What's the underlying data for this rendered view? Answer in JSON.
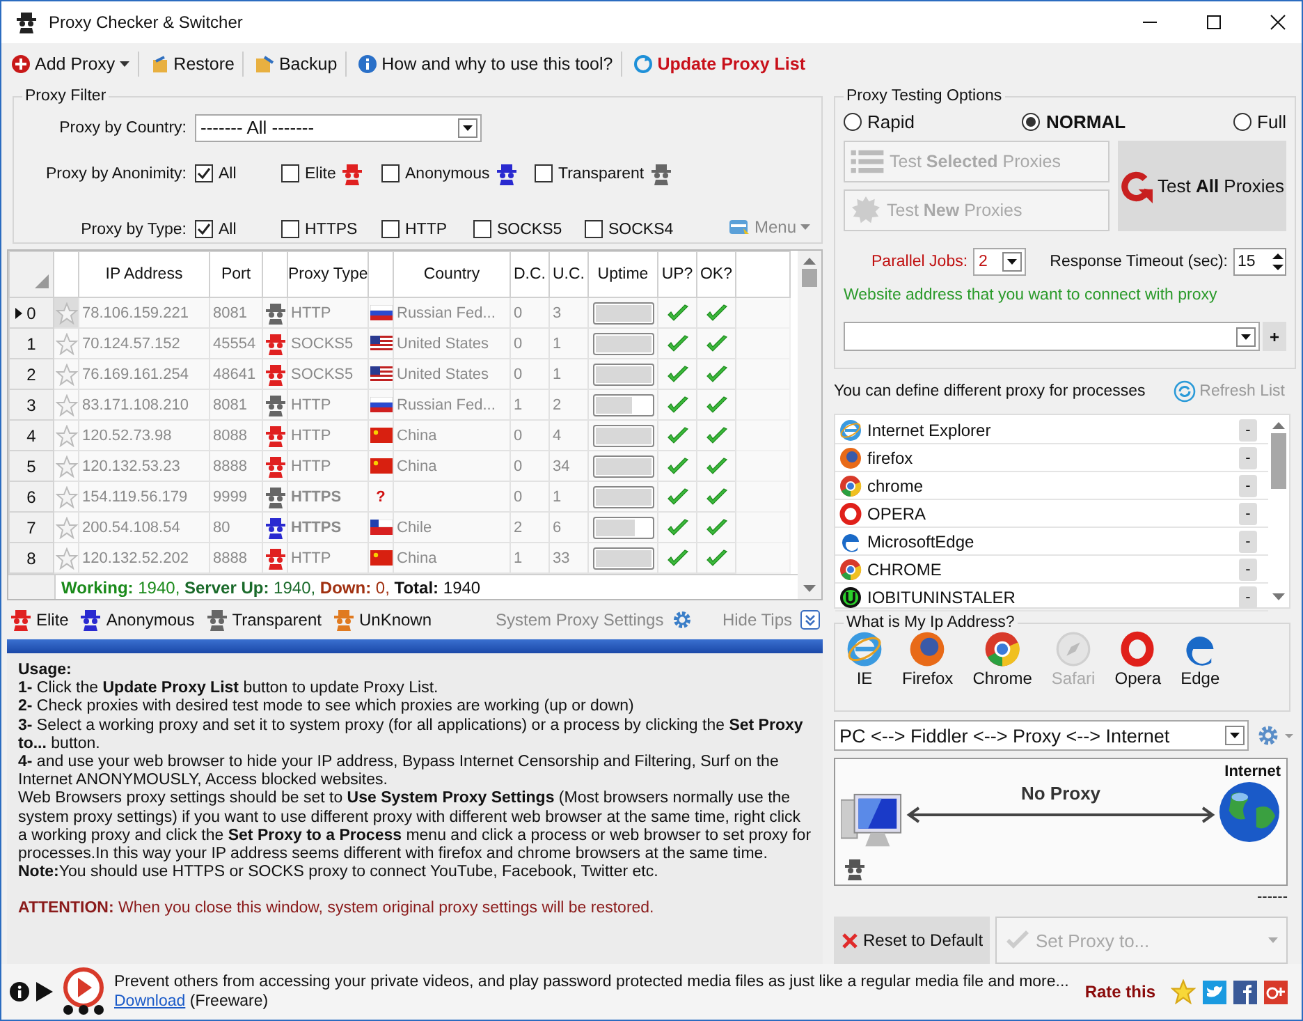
{
  "window": {
    "title": "Proxy Checker & Switcher"
  },
  "toolbar": [
    {
      "label": "Add Proxy",
      "kind": "dropdown"
    },
    {
      "label": "Restore",
      "kind": "button"
    },
    {
      "label": "Backup",
      "kind": "button"
    },
    {
      "label": "How and why to use this tool?",
      "kind": "button"
    },
    {
      "label": "Update Proxy List",
      "kind": "highlight"
    }
  ],
  "filter": {
    "title": "Proxy Filter",
    "country_label": "Proxy by Country:",
    "country_value": "------- All -------",
    "anonymity": {
      "label": "Proxy by Anonimity:",
      "options": [
        {
          "label": "All",
          "checked": true
        },
        {
          "label": "Elite",
          "checked": false,
          "kind": "elite"
        },
        {
          "label": "Anonymous",
          "checked": false,
          "kind": "anonymous"
        },
        {
          "label": "Transparent",
          "checked": false,
          "kind": "transparent"
        }
      ]
    },
    "type": {
      "label": "Proxy by Type:",
      "options": [
        {
          "label": "All",
          "checked": true
        },
        {
          "label": "HTTPS",
          "checked": false
        },
        {
          "label": "HTTP",
          "checked": false
        },
        {
          "label": "SOCKS5",
          "checked": false
        },
        {
          "label": "SOCKS4",
          "checked": false
        }
      ]
    },
    "menu_label": "Menu"
  },
  "table": {
    "columns": [
      "IP Address",
      "Port",
      "Proxy Type",
      "Country",
      "D.C.",
      "U.C.",
      "Uptime",
      "UP?",
      "OK?"
    ],
    "rows": [
      {
        "index": "0",
        "selected": true,
        "ip": "78.106.159.221",
        "port": "8081",
        "kind": "transparent",
        "type": "HTTP",
        "secure": false,
        "flag": {
          "kind": "ru"
        },
        "country": "Russian Fed...",
        "dc": "0",
        "uc": "3",
        "level": 1,
        "up": true,
        "ok": true
      },
      {
        "index": "1",
        "selected": false,
        "ip": "70.124.57.152",
        "port": "45554",
        "kind": "elite",
        "type": "SOCKS5",
        "secure": false,
        "flag": {
          "kind": "us"
        },
        "country": "United States",
        "dc": "0",
        "uc": "1",
        "level": 1,
        "up": true,
        "ok": true
      },
      {
        "index": "2",
        "selected": false,
        "ip": "76.169.161.254",
        "port": "48641",
        "kind": "elite",
        "type": "SOCKS5",
        "secure": false,
        "flag": {
          "kind": "us"
        },
        "country": "United States",
        "dc": "0",
        "uc": "1",
        "level": 1,
        "up": true,
        "ok": true
      },
      {
        "index": "3",
        "selected": false,
        "ip": "83.171.108.210",
        "port": "8081",
        "kind": "transparent",
        "type": "HTTP",
        "secure": false,
        "flag": {
          "kind": "ru"
        },
        "country": "Russian Fed...",
        "dc": "1",
        "uc": "2",
        "level": 0.65,
        "up": true,
        "ok": true
      },
      {
        "index": "4",
        "selected": false,
        "ip": "120.52.73.98",
        "port": "8088",
        "kind": "elite",
        "type": "HTTP",
        "secure": false,
        "flag": {
          "kind": "cn"
        },
        "country": "China",
        "dc": "0",
        "uc": "4",
        "level": 1,
        "up": true,
        "ok": true
      },
      {
        "index": "5",
        "selected": false,
        "ip": "120.132.53.23",
        "port": "8888",
        "kind": "elite",
        "type": "HTTP",
        "secure": false,
        "flag": {
          "kind": "cn"
        },
        "country": "China",
        "dc": "0",
        "uc": "34",
        "level": 1,
        "up": true,
        "ok": true
      },
      {
        "index": "6",
        "selected": false,
        "ip": "154.119.56.179",
        "port": "9999",
        "kind": "transparent",
        "type": "HTTPS",
        "secure": true,
        "flag": {
          "kind": "unknown",
          "mark": "?"
        },
        "dc": "0",
        "uc": "1",
        "level": 1,
        "up": true,
        "ok": true
      },
      {
        "index": "7",
        "selected": false,
        "ip": "200.54.108.54",
        "port": "80",
        "kind": "anonymous",
        "type": "HTTPS",
        "secure": true,
        "flag": {
          "kind": "cl"
        },
        "country": "Chile",
        "dc": "2",
        "uc": "6",
        "level": 0.72,
        "up": true,
        "ok": true
      },
      {
        "index": "8",
        "selected": false,
        "ip": "120.132.52.202",
        "port": "8888",
        "kind": "elite",
        "type": "HTTP",
        "secure": false,
        "flag": {
          "kind": "cn"
        },
        "country": "China",
        "dc": "1",
        "uc": "33",
        "level": 1,
        "up": true,
        "ok": true
      }
    ],
    "summary": [
      {
        "label": "Working:",
        "value": "1940,",
        "color": "#1a8a1a"
      },
      {
        "label": "Server Up:",
        "value": "1940,",
        "color": "#1a6a2a"
      },
      {
        "label": "Down:",
        "value": "0,",
        "color": "#a03010"
      },
      {
        "label": "Total:",
        "value": "1940",
        "color": "#111111"
      }
    ]
  },
  "legend": [
    {
      "label": "Elite",
      "color": "#e02020"
    },
    {
      "label": "Anonymous",
      "color": "#2a2ad0"
    },
    {
      "label": "Transparent",
      "color": "#666666"
    },
    {
      "label": "UnKnown",
      "color": "#e07a20"
    }
  ],
  "system_proxy_settings": "System Proxy Settings",
  "hide_tips": "Hide Tips",
  "usage": [
    "**Usage:**",
    "**1-**  Click the **Update Proxy List** button to update Proxy List.",
    "**2-**  Check proxies with desired test mode to see which proxies are working (up or down)",
    "**3-**  Select a working proxy and set it to system proxy (for all applications) or a process by clicking the **Set Proxy to...** button.",
    "**4-**  and use your web browser to hide your IP address, Bypass Internet Censorship and Filtering, Surf on the Internet ANONYMOUSLY, Access blocked websites.",
    "Web Browsers proxy settings should be set to **Use System Proxy Settings** (Most browsers normally use the system proxy settings) if you want to use different proxy with different web browser at the same time, right click a working proxy and click the **Set Proxy to a Process** menu and click a process or web browser to set proxy for processes.In this way your IP address seems different with firefox and chrome browsers at the same time.",
    "**Note:**You should use HTTPS or SOCKS proxy to connect YouTube, Facebook, Twitter etc."
  ],
  "attention": "**ATTENTION:** When you close this window, system original proxy settings will be restored.",
  "testing": {
    "title": "Proxy Testing Options",
    "modes": [
      {
        "label": "Rapid",
        "selected": false
      },
      {
        "label": "NORMAL",
        "selected": true
      },
      {
        "label": "Full",
        "selected": false
      }
    ],
    "test_selected": {
      "label": "Test **Selected** Proxies",
      "disabled": true
    },
    "test_new": {
      "label": "Test **New** Proxies",
      "disabled": true
    },
    "test_all": {
      "label": "Test **All** Proxies",
      "disabled": false
    },
    "parallel_label": "Parallel Jobs:",
    "parallel_value": "2",
    "timeout_label": "Response Timeout (sec):",
    "timeout_value": "15",
    "website_label": "Website address that you want to connect with proxy",
    "add_label": "+"
  },
  "processes": {
    "label": "You can define different proxy for processes",
    "refresh_label": "Refresh List",
    "items": [
      {
        "name": "Internet Explorer",
        "kind": "ie",
        "action": "-"
      },
      {
        "name": "firefox",
        "kind": "firefox",
        "action": "-"
      },
      {
        "name": "chrome",
        "kind": "chrome",
        "action": "-"
      },
      {
        "name": "OPERA",
        "kind": "opera",
        "action": "-"
      },
      {
        "name": "MicrosoftEdge",
        "kind": "edge",
        "action": "-"
      },
      {
        "name": "CHROME",
        "kind": "chrome",
        "action": "-"
      },
      {
        "name": "IOBITUNINSTALER",
        "kind": "iobit",
        "action": "-"
      }
    ]
  },
  "my_ip": {
    "title": "What is My Ip Address?",
    "browsers": [
      {
        "label": "IE",
        "kind": "ie",
        "disabled": false
      },
      {
        "label": "Firefox",
        "kind": "firefox",
        "disabled": false
      },
      {
        "label": "Chrome",
        "kind": "chrome",
        "disabled": false
      },
      {
        "label": "Safari",
        "kind": "safari",
        "disabled": true
      },
      {
        "label": "Opera",
        "kind": "opera",
        "disabled": false
      },
      {
        "label": "Edge",
        "kind": "edge",
        "disabled": false
      }
    ]
  },
  "chain": {
    "value": "PC <--> Fiddler <--> Proxy <--> Internet",
    "internet_label": "Internet",
    "status": "No Proxy",
    "dashes": "------"
  },
  "reset_label": "Reset to Default",
  "set_proxy": {
    "label": "Set Proxy to...",
    "disabled": true
  },
  "footer": {
    "text": "Prevent others from accessing your private videos, and play password protected media files as just like a regular media file and more...",
    "link": "Download",
    "note": "(Freeware)",
    "rate_label": "Rate this"
  }
}
